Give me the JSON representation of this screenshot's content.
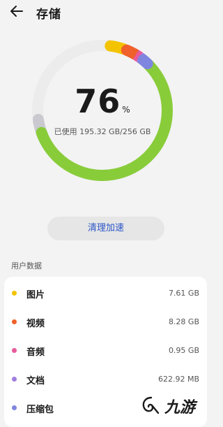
{
  "header": {
    "title": "存储",
    "back_icon": "arrow-left-icon"
  },
  "storage": {
    "percent": "76",
    "percent_unit": "%",
    "usage_text": "已使用 195.32 GB/256 GB",
    "used_fraction": 0.76,
    "colors": {
      "track": "#ececec",
      "images": "#f3c300",
      "videos": "#f0602a",
      "audio": "#e85a9c",
      "docs": "#a07ee0",
      "archives": "#7e86e0",
      "apps": "#89cc3a",
      "system": "#c9c9cf"
    }
  },
  "actions": {
    "clean_label": "清理加速"
  },
  "section": {
    "user_data_label": "用户数据"
  },
  "categories": [
    {
      "label": "图片",
      "size": "7.61 GB",
      "color": "#f3c300"
    },
    {
      "label": "视频",
      "size": "8.28 GB",
      "color": "#f0602a"
    },
    {
      "label": "音频",
      "size": "0.95 GB",
      "color": "#e85a9c"
    },
    {
      "label": "文档",
      "size": "622.92 MB",
      "color": "#a07ee0"
    },
    {
      "label": "压缩包",
      "size": "",
      "color": "#7e86e0"
    }
  ],
  "watermark": {
    "text": "九游",
    "icon": "jiuyou-logo-icon"
  }
}
